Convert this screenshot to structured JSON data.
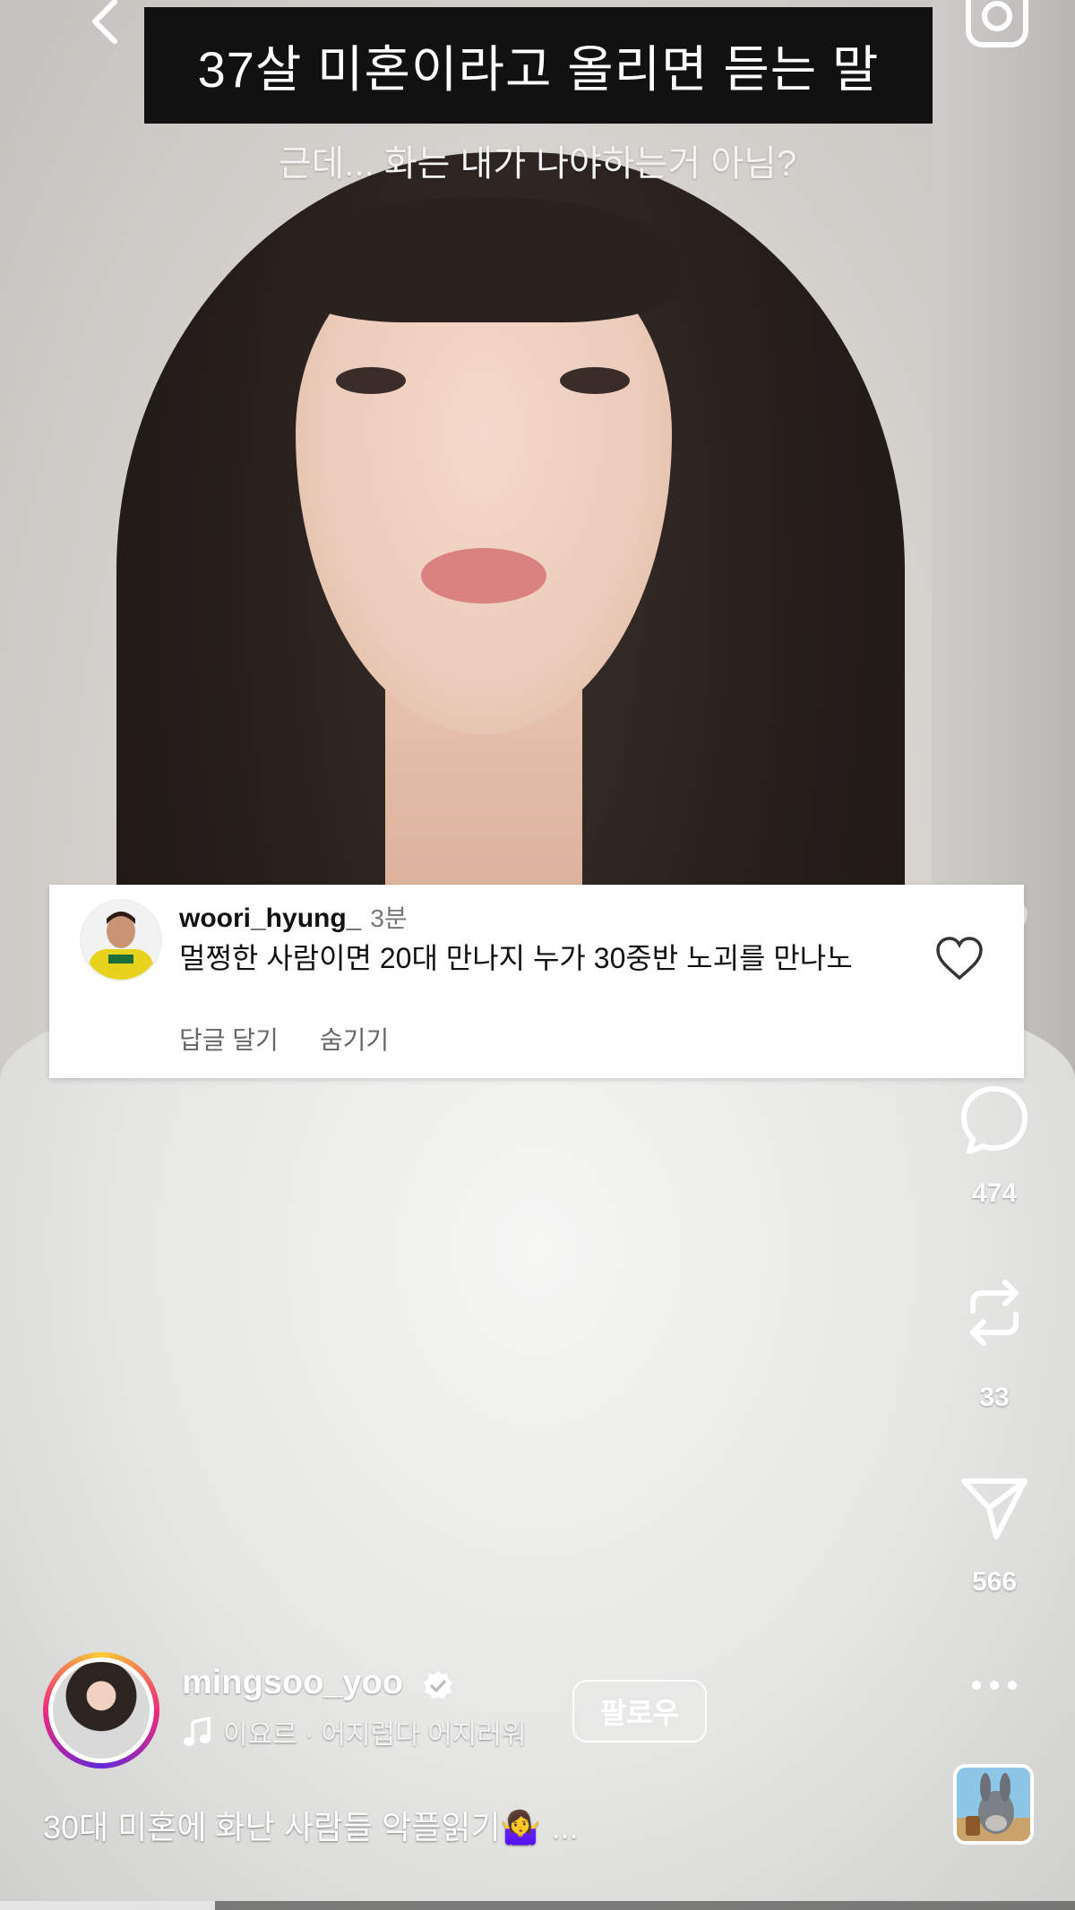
{
  "overlay": {
    "title": "37살 미혼이라고 올리면 듣는 말",
    "subtitle": "근데... 화는 내가 나야하는거 아님?"
  },
  "comment": {
    "username": "woori_hyung_",
    "time": "3분",
    "text": "멀쩡한 사람이면 20대 만나지 누가 30중반 노괴를 만나노",
    "reply_label": "답글 달기",
    "hide_label": "숨기기"
  },
  "actions": {
    "comments_count": "474",
    "reposts_count": "33",
    "shares_count": "566"
  },
  "author": {
    "username": "mingsoo_yoo",
    "music": "이요르 · 어지럽다 어지러워",
    "follow_label": "팔로우"
  },
  "caption": {
    "text": "30대 미혼에 화난 사람들 악플읽기🤷‍♀️",
    "more": "..."
  },
  "progress": 0.2,
  "icons": {
    "back": "chevron-left-icon",
    "camera": "camera-icon",
    "like": "heart-icon",
    "comment": "comment-bubble-icon",
    "repost": "repost-icon",
    "share": "send-icon",
    "more": "more-icon",
    "verified": "verified-badge-icon",
    "music": "music-note-icon"
  },
  "colors": {
    "banner_bg": "#111111",
    "comment_bg": "#ffffff",
    "verified": "#ffffff",
    "story_ring": [
      "#f9ce34",
      "#ee2a7b",
      "#6228d7"
    ]
  }
}
